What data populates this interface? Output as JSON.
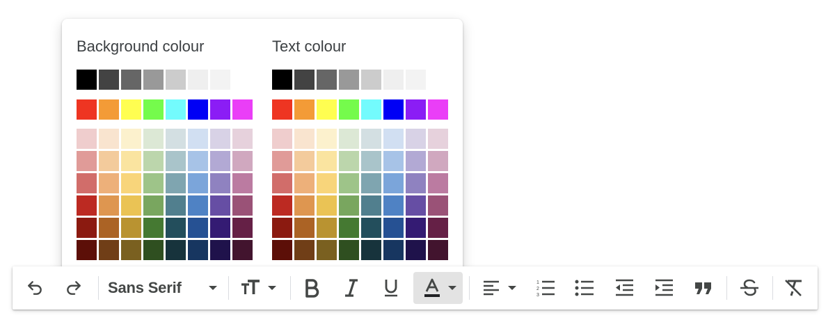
{
  "colour_menu": {
    "background_title": "Background colour",
    "text_title": "Text colour",
    "greys": [
      "#000000",
      "#434343",
      "#666666",
      "#999999",
      "#cccccc",
      "#efefef",
      "#f3f3f3",
      ""
    ],
    "brights": [
      "#ee3522",
      "#f39b37",
      "#fffe51",
      "#75fb4c",
      "#73fbfd",
      "#0000f5",
      "#8b1df5",
      "#ea3ef7"
    ],
    "shades": [
      [
        "#efcdcd",
        "#f9e4cf",
        "#fcf1cd",
        "#dce8d5",
        "#d3dfe2",
        "#d1dff2",
        "#d8d2e6",
        "#e6d1dc"
      ],
      [
        "#e09b98",
        "#f3cb9c",
        "#fae4a0",
        "#bcd6ac",
        "#a9c4ca",
        "#a7c3e7",
        "#b2a9d4",
        "#d0a8bf"
      ],
      [
        "#d16d6a",
        "#edb07a",
        "#f8d57b",
        "#9ec489",
        "#7fa5b0",
        "#7ba5da",
        "#8f82c0",
        "#bb7ba1"
      ],
      [
        "#bc2a22",
        "#de9650",
        "#eac355",
        "#79a65f",
        "#517f8e",
        "#4f82c4",
        "#664ea4",
        "#9a5277"
      ],
      [
        "#8b1a10",
        "#ab6325",
        "#b99331",
        "#457932",
        "#234e5c",
        "#265193",
        "#341b73",
        "#652046"
      ],
      [
        "#5c0f08",
        "#703e17",
        "#7a6020",
        "#2f4f20",
        "#17333c",
        "#173660",
        "#1f124b",
        "#42142e"
      ]
    ]
  },
  "toolbar": {
    "font_family": "Sans Serif",
    "buttons": {
      "undo": "undo-icon",
      "redo": "redo-icon",
      "font_size": "text-size-icon",
      "bold": "bold-icon",
      "italic": "italic-icon",
      "underline": "underline-icon",
      "text_colour": "text-colour-icon",
      "align": "align-left-icon",
      "numbered_list": "numbered-list-icon",
      "bulleted_list": "bulleted-list-icon",
      "indent_less": "indent-less-icon",
      "indent_more": "indent-more-icon",
      "quote": "quote-icon",
      "strikethrough": "strikethrough-icon",
      "remove_formatting": "remove-formatting-icon"
    }
  }
}
